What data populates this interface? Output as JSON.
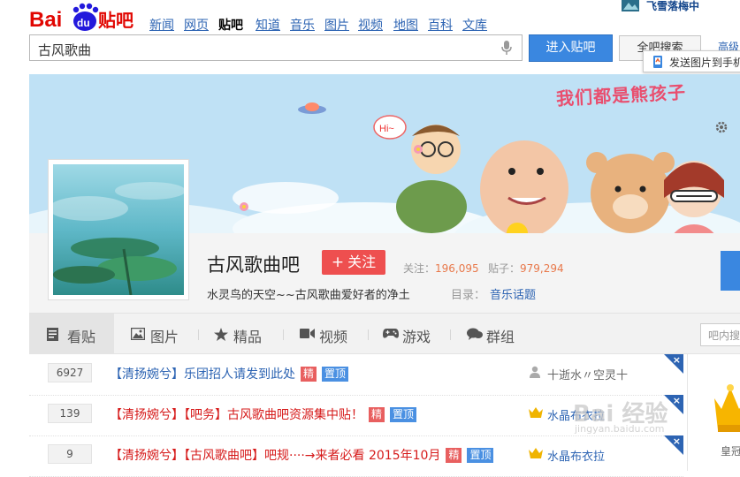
{
  "header": {
    "logo_text": "Bai du 贴吧",
    "nav": [
      "新闻",
      "网页",
      "贴吧",
      "知道",
      "音乐",
      "图片",
      "视频",
      "地图",
      "百科",
      "文库"
    ],
    "nav_active": "贴吧",
    "user_name": "飞雪落梅中"
  },
  "search": {
    "value": "古风歌曲",
    "enter_label": "进入贴吧",
    "full_search_label": "全吧搜索",
    "advanced_label": "高级",
    "send_tooltip": "发送图片到手机"
  },
  "banner": {
    "tagline": "我们都是熊孩子"
  },
  "forum": {
    "name": "古风歌曲吧",
    "follow_label": "关注",
    "followers_label": "关注：",
    "followers": "196,095",
    "posts_label": "贴子：",
    "posts": "979,294",
    "description": "水灵鸟的天空~~古风歌曲爱好者的净土",
    "directory_label": "目录：",
    "directory_value": "音乐话题"
  },
  "tabs": [
    {
      "label": "看贴",
      "icon": "document-icon",
      "active": true
    },
    {
      "label": "图片",
      "icon": "image-icon",
      "active": false
    },
    {
      "label": "精品",
      "icon": "star-icon",
      "active": false
    },
    {
      "label": "视频",
      "icon": "video-icon",
      "active": false
    },
    {
      "label": "游戏",
      "icon": "gamepad-icon",
      "active": false
    },
    {
      "label": "群组",
      "icon": "chat-icon",
      "active": false
    }
  ],
  "inner_search_placeholder": "吧内搜",
  "threads": [
    {
      "replies": "6927",
      "title": "【清扬婉兮】乐团招人请发到此处",
      "color": "blue",
      "badges": [
        "精",
        "置顶"
      ],
      "author": "十逝水〃空灵十",
      "author_icon": "user-icon"
    },
    {
      "replies": "139",
      "title": "【清扬婉兮】【吧务】古风歌曲吧资源集中贴！",
      "color": "red",
      "badges": [
        "精",
        "置顶"
      ],
      "author": "水晶布衣拉",
      "author_icon": "crown-icon"
    },
    {
      "replies": "9",
      "title": "【清扬婉兮】【古风歌曲吧】吧规····→来者必看 2015年10月",
      "color": "red",
      "badges": [
        "精",
        "置顶"
      ],
      "author": "水晶布衣拉",
      "author_icon": "crown-icon"
    }
  ],
  "right_panel": {
    "crown_label": "皇冠"
  },
  "watermark": {
    "main": "Bai 经验",
    "sub": "jingyan.baidu.com"
  },
  "colors": {
    "accent_blue": "#3a87e0",
    "link_blue": "#2d64b3",
    "follow_red": "#ee4f4f",
    "banner_sky": "#bfe1f5"
  }
}
